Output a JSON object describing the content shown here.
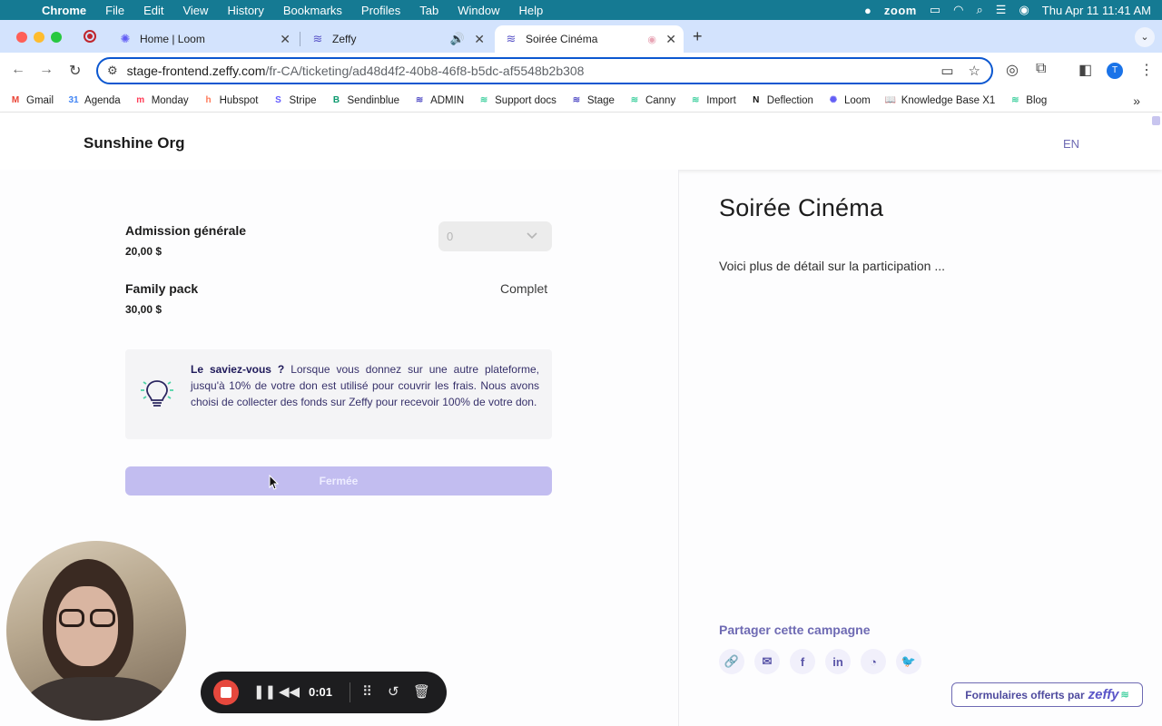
{
  "menubar": {
    "app": "Chrome",
    "items": [
      "File",
      "Edit",
      "View",
      "History",
      "Bookmarks",
      "Profiles",
      "Tab",
      "Window",
      "Help"
    ],
    "status": {
      "zoom": "zoom",
      "datetime": "Thu Apr 11  11:41 AM"
    }
  },
  "tabs": [
    {
      "title": "Home | Loom",
      "icon": "loom-icon"
    },
    {
      "title": "Zeffy",
      "icon": "zeffy-icon"
    },
    {
      "title": "Soirée Cinéma",
      "icon": "zeffy-icon",
      "active": true
    }
  ],
  "omnibox": {
    "host": "stage-frontend.zeffy.com",
    "path": "/fr-CA/ticketing/ad48d4f2-40b8-46f8-b5dc-af5548b2b308"
  },
  "profile_initial": "T",
  "bookmarks": [
    {
      "label": "Gmail",
      "icon": "M",
      "color": "#ea4335"
    },
    {
      "label": "Agenda",
      "icon": "31",
      "color": "#4285f4"
    },
    {
      "label": "Monday",
      "icon": "m",
      "color": "#ff3d57"
    },
    {
      "label": "Hubspot",
      "icon": "h",
      "color": "#ff7a59"
    },
    {
      "label": "Stripe",
      "icon": "S",
      "color": "#635bff"
    },
    {
      "label": "Sendinblue",
      "icon": "B",
      "color": "#0b996e"
    },
    {
      "label": "ADMIN",
      "icon": "≋",
      "color": "#5a55c8"
    },
    {
      "label": "Support docs",
      "icon": "≋",
      "color": "#4cd3a5"
    },
    {
      "label": "Stage",
      "icon": "≋",
      "color": "#5a55c8"
    },
    {
      "label": "Canny",
      "icon": "≋",
      "color": "#4cd3a5"
    },
    {
      "label": "Import",
      "icon": "≋",
      "color": "#4cd3a5"
    },
    {
      "label": "Deflection",
      "icon": "N",
      "color": "#111111"
    },
    {
      "label": "Loom",
      "icon": "✺",
      "color": "#625df5"
    },
    {
      "label": "Knowledge Base X1",
      "icon": "📖",
      "color": "#444444"
    },
    {
      "label": "Blog",
      "icon": "≋",
      "color": "#4cd3a5"
    }
  ],
  "header": {
    "org_name": "Sunshine Org",
    "lang_toggle": "EN"
  },
  "tickets": [
    {
      "name": "Admission générale",
      "price": "20,00 $",
      "quantity": "0"
    },
    {
      "name": "Family pack",
      "price": "30,00 $",
      "status": "Complet"
    }
  ],
  "info": {
    "lead": "Le saviez-vous ?",
    "body": " Lorsque vous donnez sur une autre plateforme, jusqu'à 10% de votre don est utilisé pour couvrir les frais. Nous avons choisi de collecter des fonds sur Zeffy pour recevoir 100% de votre don."
  },
  "submit_label": "Fermée",
  "event": {
    "title": "Soirée Cinéma",
    "description": "Voici plus de détail sur la participation ..."
  },
  "share": {
    "label": "Partager cette campagne",
    "buttons": [
      "link",
      "email",
      "facebook",
      "linkedin",
      "messenger",
      "twitter"
    ]
  },
  "powered_by": {
    "text": "Formulaires offerts par",
    "brand": "zeffy"
  },
  "loom": {
    "timer": "0:01"
  }
}
